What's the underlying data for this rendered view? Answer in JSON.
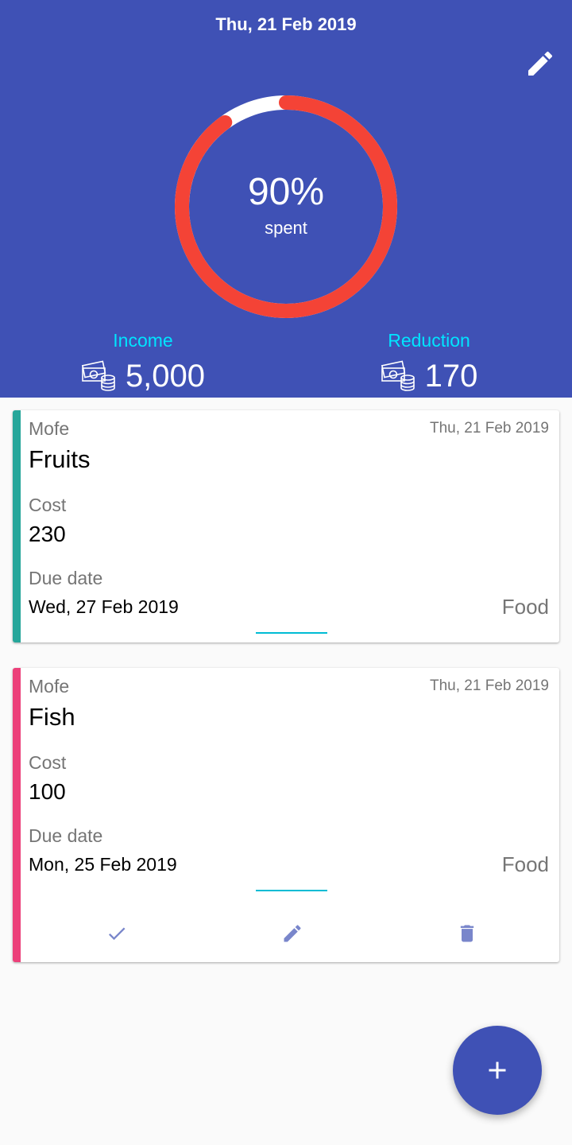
{
  "header": {
    "date": "Thu, 21 Feb 2019",
    "edit_icon": "pencil-icon",
    "budget_ring": {
      "percent_text": "90%",
      "label": "spent",
      "spent_fraction": 0.9,
      "spent_color": "#f44336",
      "remaining_color": "#ffffff"
    },
    "income": {
      "label": "Income",
      "value": "5,000",
      "icon": "money-coins-icon"
    },
    "reduction": {
      "label": "Reduction",
      "value": "170",
      "icon": "money-coins-icon"
    }
  },
  "expenses": [
    {
      "owner": "Mofe",
      "created": "Thu, 21 Feb 2019",
      "title": "Fruits",
      "cost_label": "Cost",
      "cost": "230",
      "due_label": "Due date",
      "due": "Wed, 27 Feb 2019",
      "category": "Food",
      "accent": "#26a69a"
    },
    {
      "owner": "Mofe",
      "created": "Thu, 21 Feb 2019",
      "title": "Fish",
      "cost_label": "Cost",
      "cost": "100",
      "due_label": "Due date",
      "due": "Mon, 25 Feb 2019",
      "category": "Food",
      "accent": "#ec407a",
      "actions": [
        "check-icon",
        "pencil-icon",
        "trash-icon"
      ]
    }
  ],
  "fab": {
    "icon": "plus-icon"
  },
  "colors": {
    "primary": "#3f51b5",
    "accent_text": "#00e5ff",
    "action_icon": "#7986cb"
  }
}
